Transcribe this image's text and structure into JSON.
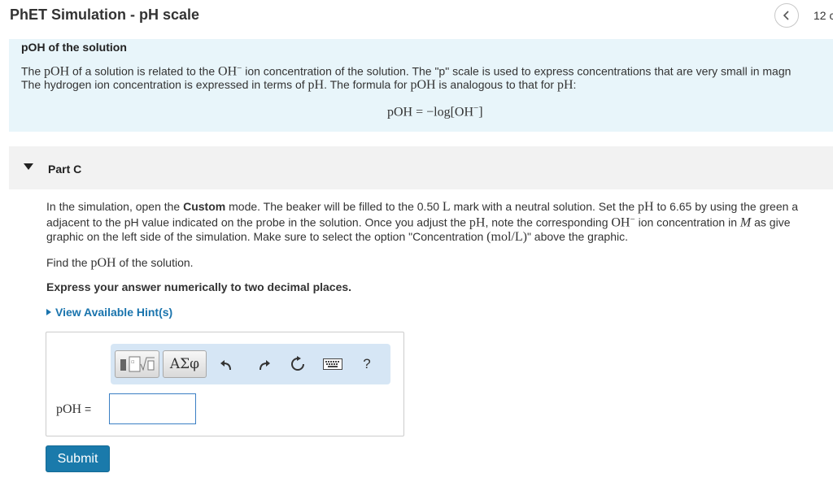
{
  "header": {
    "title": "PhET Simulation - pH scale",
    "page_number": "12 c"
  },
  "intro": {
    "title": "pOH of the solution",
    "line1_a": "The ",
    "line1_poh": "pOH",
    "line1_b": " of a solution is related to the ",
    "line1_oh": "OH",
    "line1_minus": "−",
    "line1_c": " ion concentration of the solution. The \"p\" scale is used to express concentrations that are very small in magn",
    "line2_a": "The hydrogen ion concentration is expressed in terms of ",
    "line2_ph": "pH",
    "line2_b": ". The formula for ",
    "line2_poh": "pOH",
    "line2_c": " is analogous to that for ",
    "line2_ph2": "pH",
    "line2_d": ":",
    "formula_lhs": "pOH = −log[OH",
    "formula_sup": "−",
    "formula_rhs": "]"
  },
  "part": {
    "title": "Part C"
  },
  "question": {
    "p1_a": "In the simulation, open the ",
    "p1_bold": "Custom",
    "p1_b": " mode. The beaker will be filled to the 0.50 ",
    "p1_L": "L",
    "p1_c": " mark with a neutral solution. Set the ",
    "p1_pH": "pH",
    "p1_d": " to 6.65 by using the green a",
    "p2_a": "adjacent to the pH value indicated on the probe in the solution. Once you adjust the ",
    "p2_pH": "pH",
    "p2_b": ", note the corresponding ",
    "p2_OH": "OH",
    "p2_minus": "−",
    "p2_c": " ion concentration in ",
    "p2_M": "M",
    "p2_d": " as give",
    "p3_a": "graphic on the left side of the simulation. Make sure to select the option \"Concentration ",
    "p3_unit": "(mol/L)",
    "p3_b": "\" above the graphic.",
    "find_a": "Find the ",
    "find_poh": "pOH",
    "find_b": " of the solution.",
    "express": "Express your answer numerically to two decimal places.",
    "hint_link": "View Available Hint(s)"
  },
  "answer": {
    "toolbar": {
      "templates_icon": "template-blocks-icon",
      "greek_label": "ΑΣφ",
      "undo_icon": "undo-icon",
      "redo_icon": "redo-icon",
      "reset_icon": "reset-icon",
      "keyboard_icon": "keyboard-icon",
      "help_label": "?"
    },
    "label_var": "pOH",
    "label_eq": " =",
    "input_value": "",
    "submit_label": "Submit"
  },
  "colors": {
    "intro_bg": "#e8f5fa",
    "part_bar_bg": "#f2f2f2",
    "link": "#1a74ad",
    "submit_bg": "#1a7aab",
    "toolbar_bg": "#d6e6f5",
    "input_border": "#3b7fc4"
  }
}
